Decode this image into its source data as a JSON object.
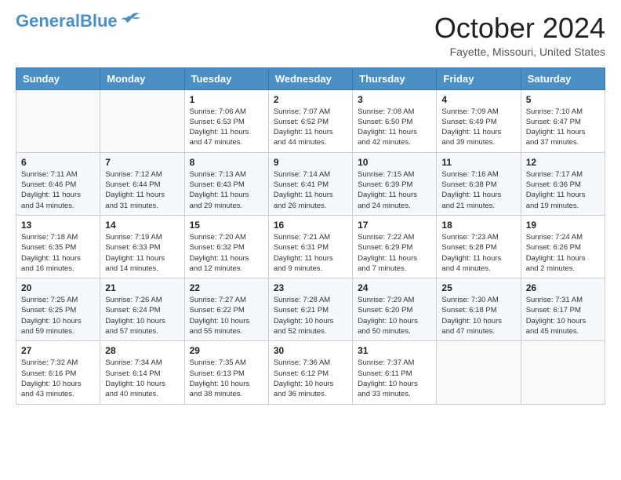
{
  "logo": {
    "line1": "General",
    "line2": "Blue"
  },
  "title": "October 2024",
  "location": "Fayette, Missouri, United States",
  "weekdays": [
    "Sunday",
    "Monday",
    "Tuesday",
    "Wednesday",
    "Thursday",
    "Friday",
    "Saturday"
  ],
  "weeks": [
    [
      {
        "day": "",
        "info": ""
      },
      {
        "day": "",
        "info": ""
      },
      {
        "day": "1",
        "info": "Sunrise: 7:06 AM\nSunset: 6:53 PM\nDaylight: 11 hours and 47 minutes."
      },
      {
        "day": "2",
        "info": "Sunrise: 7:07 AM\nSunset: 6:52 PM\nDaylight: 11 hours and 44 minutes."
      },
      {
        "day": "3",
        "info": "Sunrise: 7:08 AM\nSunset: 6:50 PM\nDaylight: 11 hours and 42 minutes."
      },
      {
        "day": "4",
        "info": "Sunrise: 7:09 AM\nSunset: 6:49 PM\nDaylight: 11 hours and 39 minutes."
      },
      {
        "day": "5",
        "info": "Sunrise: 7:10 AM\nSunset: 6:47 PM\nDaylight: 11 hours and 37 minutes."
      }
    ],
    [
      {
        "day": "6",
        "info": "Sunrise: 7:11 AM\nSunset: 6:46 PM\nDaylight: 11 hours and 34 minutes."
      },
      {
        "day": "7",
        "info": "Sunrise: 7:12 AM\nSunset: 6:44 PM\nDaylight: 11 hours and 31 minutes."
      },
      {
        "day": "8",
        "info": "Sunrise: 7:13 AM\nSunset: 6:43 PM\nDaylight: 11 hours and 29 minutes."
      },
      {
        "day": "9",
        "info": "Sunrise: 7:14 AM\nSunset: 6:41 PM\nDaylight: 11 hours and 26 minutes."
      },
      {
        "day": "10",
        "info": "Sunrise: 7:15 AM\nSunset: 6:39 PM\nDaylight: 11 hours and 24 minutes."
      },
      {
        "day": "11",
        "info": "Sunrise: 7:16 AM\nSunset: 6:38 PM\nDaylight: 11 hours and 21 minutes."
      },
      {
        "day": "12",
        "info": "Sunrise: 7:17 AM\nSunset: 6:36 PM\nDaylight: 11 hours and 19 minutes."
      }
    ],
    [
      {
        "day": "13",
        "info": "Sunrise: 7:18 AM\nSunset: 6:35 PM\nDaylight: 11 hours and 16 minutes."
      },
      {
        "day": "14",
        "info": "Sunrise: 7:19 AM\nSunset: 6:33 PM\nDaylight: 11 hours and 14 minutes."
      },
      {
        "day": "15",
        "info": "Sunrise: 7:20 AM\nSunset: 6:32 PM\nDaylight: 11 hours and 12 minutes."
      },
      {
        "day": "16",
        "info": "Sunrise: 7:21 AM\nSunset: 6:31 PM\nDaylight: 11 hours and 9 minutes."
      },
      {
        "day": "17",
        "info": "Sunrise: 7:22 AM\nSunset: 6:29 PM\nDaylight: 11 hours and 7 minutes."
      },
      {
        "day": "18",
        "info": "Sunrise: 7:23 AM\nSunset: 6:28 PM\nDaylight: 11 hours and 4 minutes."
      },
      {
        "day": "19",
        "info": "Sunrise: 7:24 AM\nSunset: 6:26 PM\nDaylight: 11 hours and 2 minutes."
      }
    ],
    [
      {
        "day": "20",
        "info": "Sunrise: 7:25 AM\nSunset: 6:25 PM\nDaylight: 10 hours and 59 minutes."
      },
      {
        "day": "21",
        "info": "Sunrise: 7:26 AM\nSunset: 6:24 PM\nDaylight: 10 hours and 57 minutes."
      },
      {
        "day": "22",
        "info": "Sunrise: 7:27 AM\nSunset: 6:22 PM\nDaylight: 10 hours and 55 minutes."
      },
      {
        "day": "23",
        "info": "Sunrise: 7:28 AM\nSunset: 6:21 PM\nDaylight: 10 hours and 52 minutes."
      },
      {
        "day": "24",
        "info": "Sunrise: 7:29 AM\nSunset: 6:20 PM\nDaylight: 10 hours and 50 minutes."
      },
      {
        "day": "25",
        "info": "Sunrise: 7:30 AM\nSunset: 6:18 PM\nDaylight: 10 hours and 47 minutes."
      },
      {
        "day": "26",
        "info": "Sunrise: 7:31 AM\nSunset: 6:17 PM\nDaylight: 10 hours and 45 minutes."
      }
    ],
    [
      {
        "day": "27",
        "info": "Sunrise: 7:32 AM\nSunset: 6:16 PM\nDaylight: 10 hours and 43 minutes."
      },
      {
        "day": "28",
        "info": "Sunrise: 7:34 AM\nSunset: 6:14 PM\nDaylight: 10 hours and 40 minutes."
      },
      {
        "day": "29",
        "info": "Sunrise: 7:35 AM\nSunset: 6:13 PM\nDaylight: 10 hours and 38 minutes."
      },
      {
        "day": "30",
        "info": "Sunrise: 7:36 AM\nSunset: 6:12 PM\nDaylight: 10 hours and 36 minutes."
      },
      {
        "day": "31",
        "info": "Sunrise: 7:37 AM\nSunset: 6:11 PM\nDaylight: 10 hours and 33 minutes."
      },
      {
        "day": "",
        "info": ""
      },
      {
        "day": "",
        "info": ""
      }
    ]
  ]
}
